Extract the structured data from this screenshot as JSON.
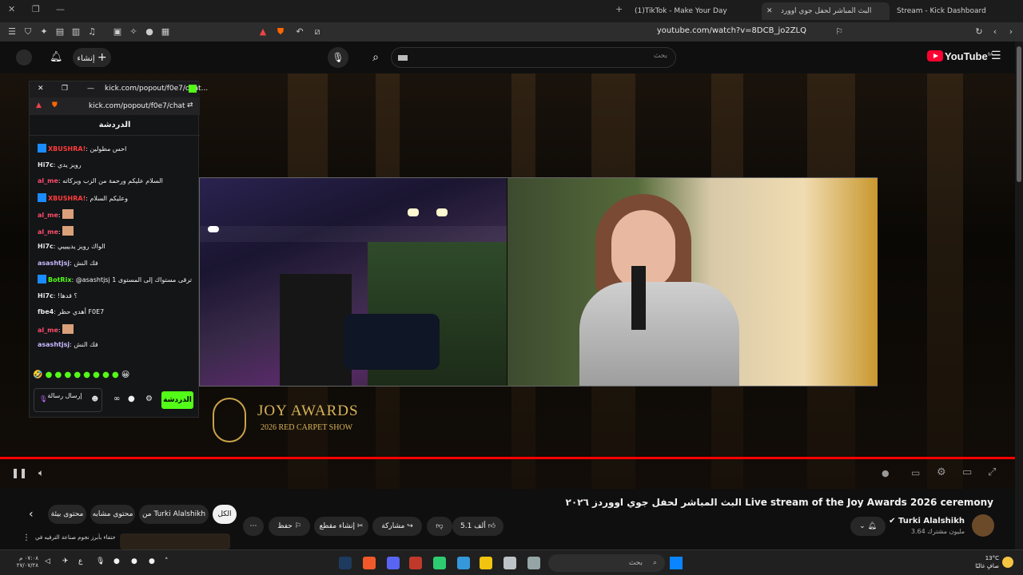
{
  "browser": {
    "tabs": [
      {
        "label": "Stream - Kick Dashboard"
      },
      {
        "label": "البث المباشر لحفل جوي اوورد"
      },
      {
        "label": "(1)TikTok - Make Your Day"
      }
    ],
    "url": "youtube.com/watch?v=8DCB_jo2ZLQ"
  },
  "youtube": {
    "create_label": "إنشاء",
    "search_placeholder": "بحث",
    "logo_text": "YouTube",
    "logo_region": "SA"
  },
  "chat": {
    "popout_url_short": "kick.com/popout/f0e7/chat...",
    "popout_url": "kick.com/popout/f0e7/chat",
    "header": "الدردشة",
    "messages": [
      {
        "user": "XBUSHRA!",
        "text": "احس مطولين",
        "color": "#ff3b3b"
      },
      {
        "user": "Hi7c",
        "text": "رويز يدي",
        "color": "#e8e8e8"
      },
      {
        "user": "al_me",
        "text": "السلام عليكم ورحمة من الزب ويركاته",
        "color": "#ff4d6d"
      },
      {
        "user": "XBUSHRA!",
        "text": "وعليكم السلام",
        "color": "#ff3b3b"
      },
      {
        "user": "al_me",
        "text": "",
        "color": "#ff4d6d"
      },
      {
        "user": "al_me",
        "text": "",
        "color": "#ff4d6d"
      },
      {
        "user": "Hi7c",
        "text": "الواك رويز يدييييي",
        "color": "#e8e8e8"
      },
      {
        "user": "asashtjsj",
        "text": "فك النش",
        "color": "#c9b8ff"
      },
      {
        "user": "BotRix",
        "text": "@asashtjsj لقد ترقى مستواك إلى المستوى 1",
        "color": "#53fc18"
      },
      {
        "user": "Hi7c",
        "text": "!؟ قدها",
        "color": "#e8e8e8"
      },
      {
        "user": "fbe4",
        "text": "أهدي حظر F0E7",
        "color": "#e8e8e8"
      },
      {
        "user": "al_me",
        "text": "",
        "color": "#ff4d6d"
      },
      {
        "user": "asashtjsj",
        "text": "فك النش",
        "color": "#c9b8ff"
      }
    ],
    "input_placeholder": "إرسال رسالة",
    "send_label": "الدردشة"
  },
  "video": {
    "logo_title": "JOY AWARDS",
    "logo_subtitle": "2026 RED CARPET SHOW",
    "title": "البث المباشر لحفل جوي اووردز ٢٠٢٦ Live stream of the Joy Awards 2026 ceremony",
    "progress_fraction": 1.0
  },
  "channel": {
    "name": "Turki Alalshikh",
    "subscribers": "3.64 مليون مشترك"
  },
  "actions": {
    "likes": "5.1 ألف",
    "share": "مشاركة",
    "clip": "إنشاء مقطع",
    "save": "حفظ"
  },
  "filters": {
    "chips": [
      "الكل",
      "من Turki Alalshikh",
      "محتوى مشابه",
      "محتوى بيئة"
    ]
  },
  "recommended": {
    "title": "البث المباشر للاحتفاء بأبرز نجوم صناعة الترفيه في...",
    "title2": "..."
  },
  "taskbar": {
    "search_placeholder": "بحث",
    "time": "٠٧:٠٨ م",
    "date": "٢٧/٠٧/٢٨",
    "weather_temp": "13°C",
    "weather_desc": "صافٍ غالبًا",
    "lang": "ع"
  }
}
